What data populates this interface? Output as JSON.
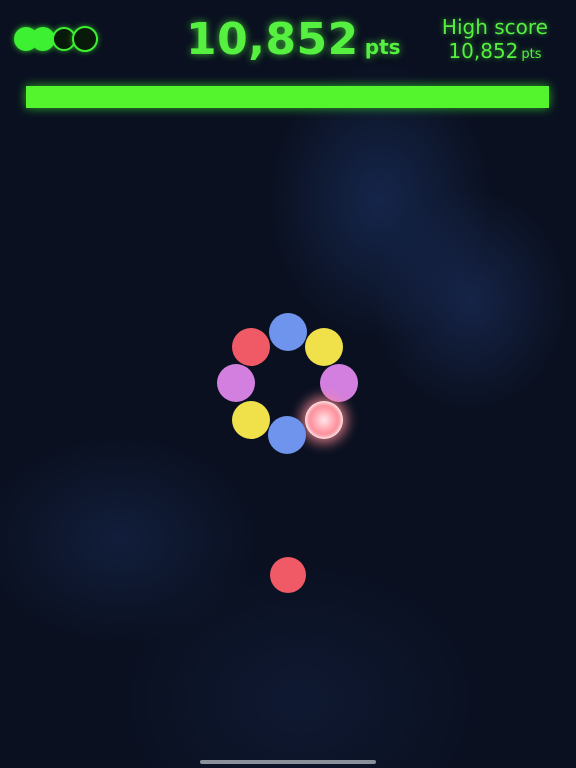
{
  "hud": {
    "lives": {
      "total": 4,
      "remaining": 2
    },
    "score_value": "10,852",
    "score_unit": "pts",
    "high_score_label": "High score",
    "high_score_value": "10,852",
    "high_score_unit": "pts",
    "timer_fraction": 1.0
  },
  "ring_colors": [
    "blue",
    "yellow",
    "purple",
    "red-glowing",
    "blue",
    "yellow",
    "purple",
    "red"
  ],
  "shooter_color": "red",
  "colors": {
    "accent": "#55f040",
    "red": "#ef5a66",
    "blue": "#6f94ee",
    "yellow": "#f0e04a",
    "purple": "#d27fdf",
    "background": "#0a1020"
  }
}
